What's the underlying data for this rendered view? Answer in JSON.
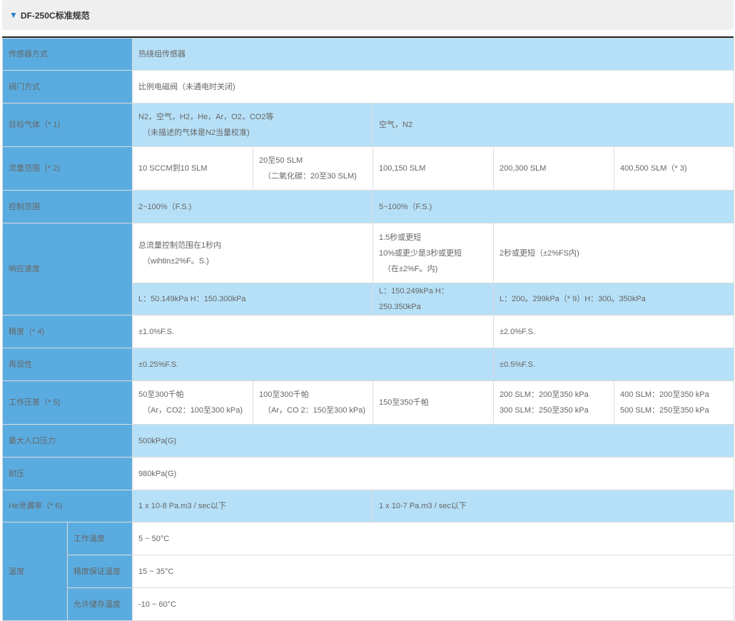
{
  "header": {
    "triangle": "▼",
    "title": "DF-250C标准规范"
  },
  "rows": {
    "sensor": {
      "label": "传感器方式",
      "value": "热绕组传感器"
    },
    "valve": {
      "label": "阀门方式",
      "value": "比例电磁阀（未通电时关闭)"
    },
    "gas": {
      "label": "目标气体（* 1)",
      "v1a": "N2，空气，H2，He，Ar，O2，CO2等",
      "v1b": "（未描述的气体是N2当量校准)",
      "v2": "空气，N2"
    },
    "flow": {
      "label": "流量范围（* 2)",
      "c1": "10 SCCM到10 SLM",
      "c2a": "20至50 SLM",
      "c2b": "（二氧化碳：20至30 SLM)",
      "c3": "100,150 SLM",
      "c4": "200,300 SLM",
      "c5": "400,500 SLM（* 3)"
    },
    "control": {
      "label": "控制范围",
      "c1": "2~100%（F.S.)",
      "c2": "5~100%（F.S.)"
    },
    "response": {
      "label": "响应速度",
      "c1a": "总流量控制范围在1秒内",
      "c1b": "（wihtin±2%F。S.)",
      "c2a": "1.5秒或更短",
      "c2b": "10%或更少是3秒或更短",
      "c2c": "（在±2%F。内)",
      "c3": "2秒或更短（±2%FS内)",
      "p1": "L：50.149kPa H：150.300kPa",
      "p2": "L：150.249kPa H：250.350kPa",
      "p3": "L：200。299kPa（* 9）H：300。350kPa"
    },
    "accuracy": {
      "label": "精度（* 4)",
      "c1": "±1.0%F.S.",
      "c2": "±2.0%F.S."
    },
    "repeat": {
      "label": "再现性",
      "c1": "±0.25%F.S.",
      "c2": "±0.5%F.S."
    },
    "pressure": {
      "label": "工作压差（* 5)",
      "c1a": "50至300千帕",
      "c1b": "（Ar，CO2：100至300 kPa)",
      "c2a": "100至300千帕",
      "c2b": "（Ar，CO 2：150至300 kPa)",
      "c3": "150至350千帕",
      "c4a": "200 SLM：200至350 kPa",
      "c4b": "300 SLM：250至350 kPa",
      "c5a": "400 SLM：200至350 kPa",
      "c5b": "500 SLM：250至350 kPa"
    },
    "maxinlet": {
      "label": "最大入口压力",
      "value": "500kPa(G)"
    },
    "withstand": {
      "label": "耐压",
      "value": "980kPa(G)"
    },
    "leak": {
      "label": "He泄漏率（* 6)",
      "c1": "1 x 10-8 Pa.m3 / sec以下",
      "c2": "1 x 10-7 Pa.m3 / sec以下"
    },
    "temp": {
      "label": "温度",
      "op_label": "工作温度",
      "op_value": "5 ~ 50°C",
      "acc_label": "精度保证温度",
      "acc_value": "15 ~ 35°C",
      "store_label": "允许储存温度",
      "store_value": "-10 ~ 60°C"
    }
  },
  "colors": {
    "label_bg": "#5aace0",
    "band_bg": "#b6e0f7",
    "accent": "#2b7fc4"
  }
}
